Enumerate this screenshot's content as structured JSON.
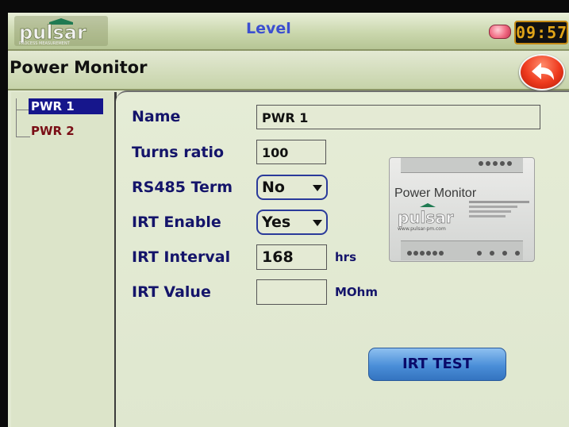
{
  "header": {
    "logo_text": "pulsar",
    "logo_tagline": "PROCESS MEASUREMENT",
    "title": "Level",
    "clock": "09:57",
    "alarm_color": "#f06a82"
  },
  "page": {
    "title": "Power Monitor",
    "back_icon": "back-arrow-icon"
  },
  "tree": {
    "items": [
      {
        "label": "PWR 1",
        "selected": true
      },
      {
        "label": "PWR 2",
        "selected": false
      }
    ]
  },
  "form": {
    "name": {
      "label": "Name",
      "value": "PWR 1"
    },
    "turns_ratio": {
      "label": "Turns ratio",
      "value": "100"
    },
    "rs485_term": {
      "label": "RS485 Term",
      "value": "No"
    },
    "irt_enable": {
      "label": "IRT Enable",
      "value": "Yes"
    },
    "irt_interval": {
      "label": "IRT Interval",
      "value": "168",
      "unit": "hrs"
    },
    "irt_value": {
      "label": "IRT Value",
      "value": "",
      "unit": "MOhm"
    },
    "irt_test_button": "IRT TEST"
  },
  "device_image": {
    "title": "Power Monitor",
    "website": "www.pulsar-pm.com"
  },
  "colors": {
    "label_text": "#14146a",
    "selected_item_bg": "#16168c",
    "unselected_item_text": "#7a0e16",
    "button_blue": "#4a8ed8"
  }
}
